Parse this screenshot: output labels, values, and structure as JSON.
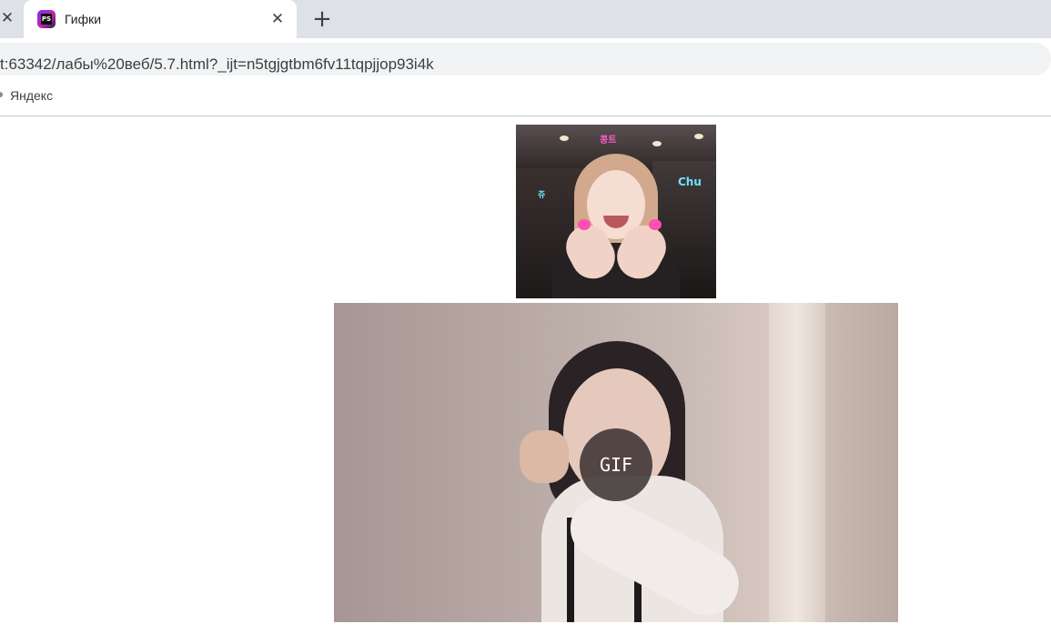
{
  "browser": {
    "tab": {
      "title": "Гифки",
      "favicon_label": "PS",
      "favicon_icon": "phpstorm-icon"
    },
    "tab_close_glyph": "✕",
    "new_tab_glyph": "+",
    "address": "t:63342/лабы%20веб/5.7.html?_ijt=n5tgjgtbm6fv11tqpjjop93i4k",
    "bookmarks": [
      {
        "label": "Яндекс"
      }
    ]
  },
  "page": {
    "images": [
      {
        "name": "heart-hands-gif",
        "stickers": [
          "콩트",
          "Chu",
          "쥬"
        ]
      },
      {
        "name": "wink-punch-gif",
        "badge": "GIF"
      }
    ]
  },
  "colors": {
    "tabstrip": "#dee1e6",
    "omnibox": "#f1f3f4",
    "badge_bg": "#282020"
  }
}
